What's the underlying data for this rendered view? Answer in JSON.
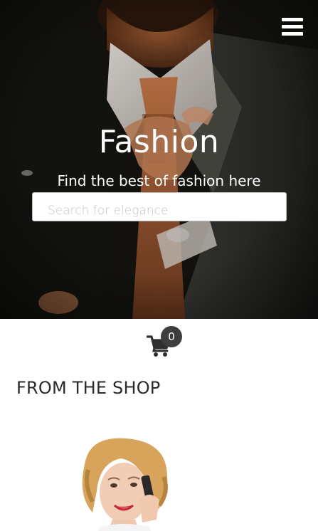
{
  "header": {
    "menu_icon": "hamburger-menu-icon"
  },
  "hero": {
    "title": "Fashion",
    "subtitle": "Find the best of fashion here",
    "search_placeholder": "Search for elegance"
  },
  "cart": {
    "icon": "shopping-cart-icon",
    "count": "0"
  },
  "shop": {
    "heading": "FROM THE SHOP"
  },
  "colors": {
    "hero_background": "#1c1a16",
    "text_dark": "#2b2b2b",
    "badge_background": "#3e3e3e",
    "white": "#ffffff"
  }
}
